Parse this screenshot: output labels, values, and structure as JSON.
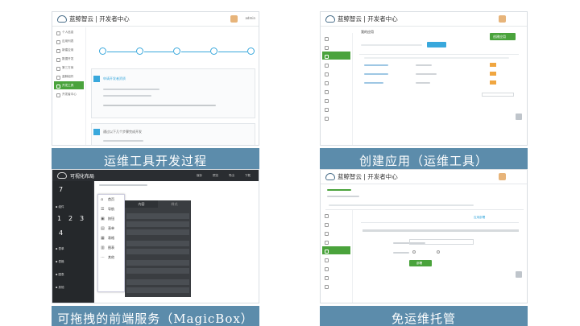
{
  "panels": [
    {
      "caption": "运维工具开发过程",
      "brand": "蓝鲸智云 | 开发者中心",
      "sidebar": [
        "个人信息",
        "应用列表",
        "新建应用",
        "数据开发",
        "第三方库",
        "蓝鲸组件",
        "开发工具",
        "开发者中心"
      ],
      "box_text_1": "申请开发者资质",
      "box_text_2": "通过以下几个步骤完成开发"
    },
    {
      "caption": "创建应用（运维工具）",
      "brand": "蓝鲸智云 | 开发者中心",
      "toolbar_label": "我的应用",
      "create_label": "创建应用"
    },
    {
      "caption": "可拖拽的前端服务（MagicBox）",
      "brand": "可视化布局",
      "numpad": [
        "7",
        "1",
        "2",
        "3",
        "4"
      ],
      "menu": [
        "首页",
        "导航",
        "按钮",
        "表单",
        "表格",
        "图表",
        "其他"
      ],
      "drawer_tabs": [
        "内容",
        "样式"
      ],
      "top_actions": [
        "保存",
        "预览",
        "导出",
        "下载"
      ]
    },
    {
      "caption": "免运维托管",
      "brand": "蓝鲸智云 | 开发者中心",
      "deploy_label": "部署",
      "tab_label": "应用部署"
    }
  ],
  "colors": {
    "caption_bg": "#5c8cab",
    "green": "#4aa33c",
    "blue": "#39a8dc",
    "dark": "#2f3236"
  },
  "icons": [
    "cloud-logo-icon",
    "user-avatar-icon",
    "scroll-top-icon"
  ]
}
